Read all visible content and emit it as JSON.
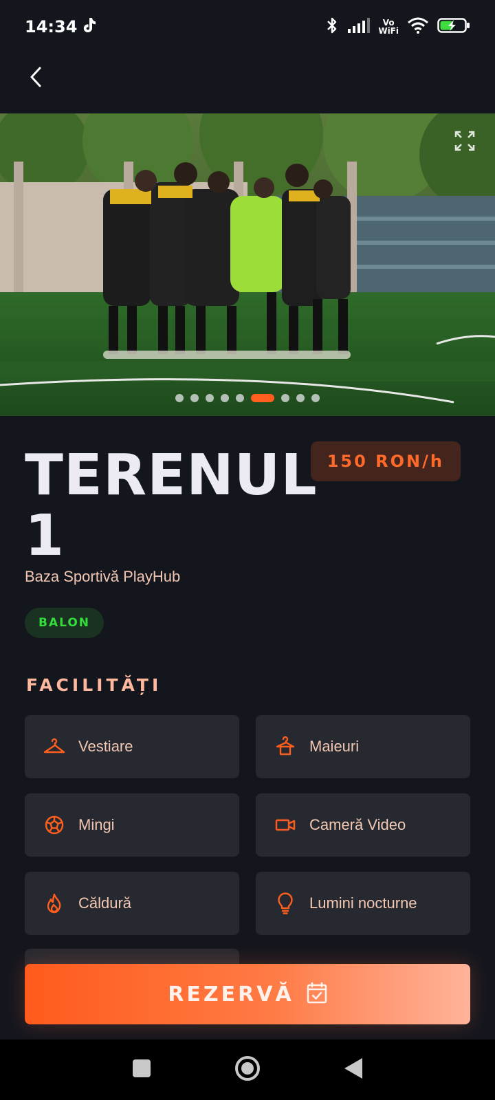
{
  "status_bar": {
    "time": "14:34",
    "vowifi_top": "Vo",
    "vowifi_bottom": "WiFi"
  },
  "hero": {
    "image_count": 9,
    "active_index": 5
  },
  "field": {
    "title": "TERENUL 1",
    "price": "150 RON/h",
    "venue": "Baza Sportivă PlayHub",
    "tag": "BALON"
  },
  "facilities": {
    "title": "FACILITĂȚI",
    "items": [
      {
        "label": "Vestiare",
        "icon": "hanger-icon"
      },
      {
        "label": "Maieuri",
        "icon": "jersey-icon"
      },
      {
        "label": "Mingi",
        "icon": "soccer-ball-icon"
      },
      {
        "label": "Cameră Video",
        "icon": "video-camera-icon"
      },
      {
        "label": "Căldură",
        "icon": "flame-icon"
      },
      {
        "label": "Lumini nocturne",
        "icon": "lightbulb-icon"
      }
    ]
  },
  "actions": {
    "book_label": "REZERVĂ"
  },
  "colors": {
    "accent": "#ff5e1f",
    "background": "#14161e",
    "card": "#272930",
    "tag_green": "#33dd3a",
    "peach_text": "#f2c8b3"
  }
}
